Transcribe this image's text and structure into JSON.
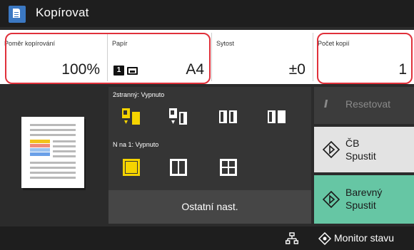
{
  "header": {
    "title": "Kopírovat"
  },
  "settings": {
    "ratio": {
      "label": "Poměr kopírování",
      "value": "100%"
    },
    "paper": {
      "label": "Papír",
      "tray1": "1",
      "value": "A4"
    },
    "density": {
      "label": "Sytost",
      "value": "±0"
    },
    "copies": {
      "label": "Počet kopií",
      "value": "1"
    }
  },
  "duplex": {
    "label": "2stranný: Vypnuto"
  },
  "nup": {
    "label": "N na 1: Vypnuto"
  },
  "other_label": "Ostatní nast.",
  "buttons": {
    "reset": "Resetovat",
    "bw_start_line1": "ČB",
    "bw_start_line2": "Spustit",
    "color_start_line1": "Barevný",
    "color_start_line2": "Spustit"
  },
  "footer": {
    "monitor": "Monitor stavu"
  },
  "colors": {
    "accent_yellow": "#f5d400",
    "start_green": "#66c6a4",
    "highlight_red": "#e0303a"
  }
}
